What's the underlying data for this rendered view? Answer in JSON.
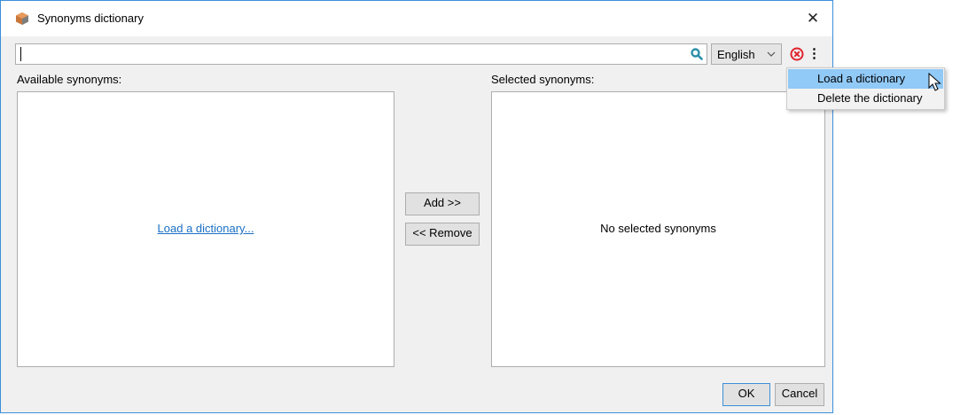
{
  "window": {
    "title": "Synonyms dictionary",
    "close_glyph": "✕"
  },
  "toolbar": {
    "search_value": "",
    "language": "English",
    "more_glyph": "⋮"
  },
  "available": {
    "label": "Available synonyms:",
    "load_link": "Load a dictionary..."
  },
  "selected": {
    "label": "Selected synonyms:",
    "empty_text": "No selected synonyms"
  },
  "buttons": {
    "add": "Add >>",
    "remove": "<< Remove",
    "ok": "OK",
    "cancel": "Cancel"
  },
  "menu": {
    "items": [
      {
        "label": "Load a dictionary",
        "highlighted": true
      },
      {
        "label": "Delete the dictionary",
        "highlighted": false
      }
    ]
  },
  "icons": {
    "app": "cube-icon",
    "search": "search-icon",
    "clear": "clear-icon",
    "more": "more-vertical-icon",
    "dropdown": "chevron-down-icon",
    "cursor": "mouse-pointer-icon"
  },
  "colors": {
    "window_border": "#3c8fd8",
    "link": "#1a6fc4",
    "menu_highlight": "#91c9f7",
    "clear_icon": "#e0242e",
    "search_icon": "#2a8fa8"
  }
}
